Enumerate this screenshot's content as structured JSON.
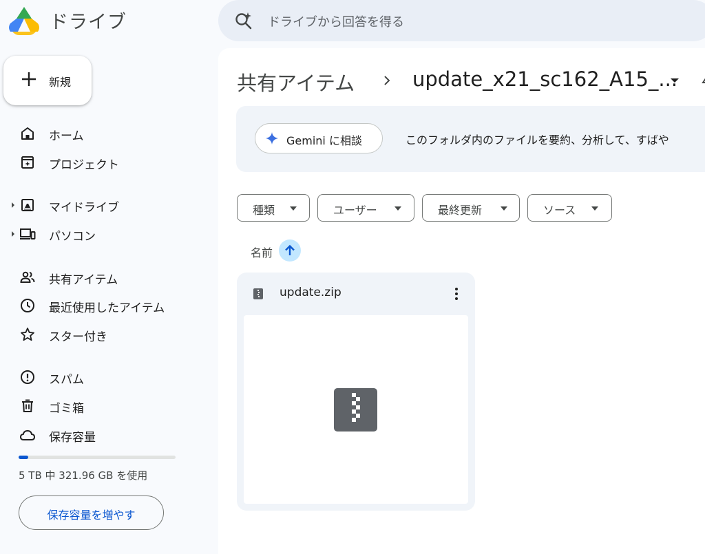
{
  "app": {
    "title": "ドライブ"
  },
  "search": {
    "placeholder": "ドライブから回答を得る"
  },
  "sidebar": {
    "new_label": "新規",
    "items": [
      {
        "label": "ホーム",
        "icon": "home-icon"
      },
      {
        "label": "プロジェクト",
        "icon": "projects-icon"
      },
      {
        "label": "マイドライブ",
        "icon": "my-drive-icon",
        "expandable": true
      },
      {
        "label": "パソコン",
        "icon": "computers-icon",
        "expandable": true
      },
      {
        "label": "共有アイテム",
        "icon": "shared-people-icon"
      },
      {
        "label": "最近使用したアイテム",
        "icon": "clock-icon"
      },
      {
        "label": "スター付き",
        "icon": "star-icon"
      },
      {
        "label": "スパム",
        "icon": "spam-icon"
      },
      {
        "label": "ゴミ箱",
        "icon": "trash-icon"
      },
      {
        "label": "保存容量",
        "icon": "cloud-icon"
      }
    ],
    "storage": {
      "used_fraction": 0.06,
      "text": "5 TB 中 321.96 GB を使用"
    },
    "upgrade_label": "保存容量を増やす"
  },
  "breadcrumb": {
    "root": "共有アイテム",
    "current": "update_x21_sc162_A15_..."
  },
  "gemini": {
    "button_label": "Gemini に相談",
    "description": "このフォルダ内のファイルを要約、分析して、すばや"
  },
  "filters": [
    {
      "label": "種類"
    },
    {
      "label": "ユーザー"
    },
    {
      "label": "最終更新"
    },
    {
      "label": "ソース"
    }
  ],
  "sort": {
    "label": "名前",
    "direction": "ascending"
  },
  "files": [
    {
      "name": "update.zip",
      "type": "zip-archive"
    }
  ],
  "colors": {
    "accent": "#0b57d0",
    "sort_chip_bg": "#c2e7ff",
    "search_bg": "#e9eef6",
    "card_bg": "#f0f4f9",
    "zip_icon": "#5f6368"
  }
}
